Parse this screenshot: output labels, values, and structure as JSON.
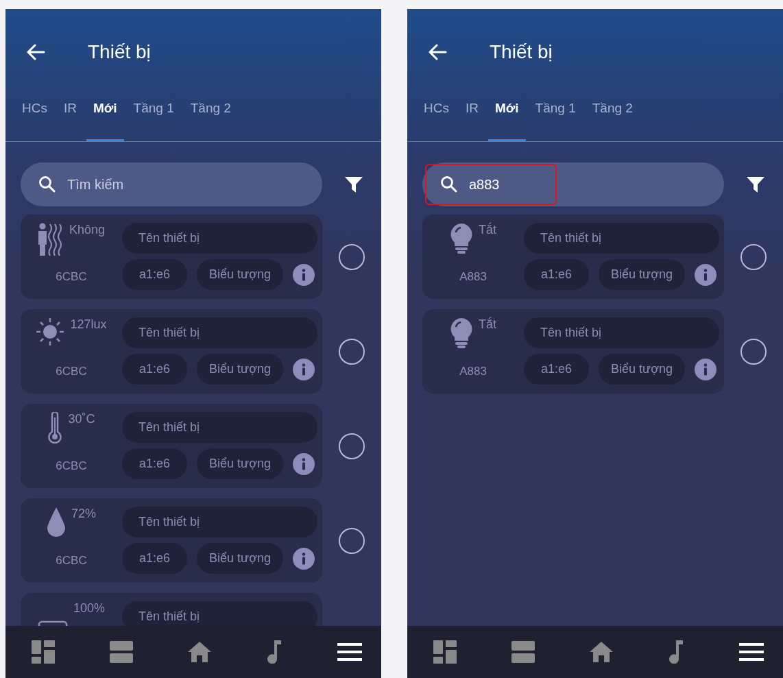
{
  "screens": [
    {
      "title": "Thiết bị",
      "tabs": [
        {
          "label": "HCs",
          "selected": false
        },
        {
          "label": "IR",
          "selected": false
        },
        {
          "label": "Mới",
          "selected": true
        },
        {
          "label": "Tầng 1",
          "selected": false
        },
        {
          "label": "Tầng 2",
          "selected": false
        }
      ],
      "search": {
        "placeholder": "Tìm kiếm",
        "highlighted": false
      },
      "devices": [
        {
          "kind": "presence",
          "reading": "Không",
          "code": "6CBC",
          "name_placeholder": "Tên thiết bị",
          "address": "a1:e6",
          "icon_label": "Biểu tượng",
          "selected": false
        },
        {
          "kind": "light",
          "reading": "127lux",
          "code": "6CBC",
          "name_placeholder": "Tên thiết bị",
          "address": "a1:e6",
          "icon_label": "Biểu tượng",
          "selected": false
        },
        {
          "kind": "temperature",
          "reading": "30˚C",
          "code": "6CBC",
          "name_placeholder": "Tên thiết bị",
          "address": "a1:e6",
          "icon_label": "Biểu tượng",
          "selected": false
        },
        {
          "kind": "humidity",
          "reading": "72%",
          "code": "6CBC",
          "name_placeholder": "Tên thiết bị",
          "address": "a1:e6",
          "icon_label": "Biểu tượng",
          "selected": false
        },
        {
          "kind": "battery",
          "reading": "100%",
          "name_placeholder": "Tên thiết bị"
        }
      ],
      "nav": [
        {
          "kind": "dashboard",
          "selected": false
        },
        {
          "kind": "rooms",
          "selected": false
        },
        {
          "kind": "home",
          "selected": false
        },
        {
          "kind": "music",
          "selected": false
        },
        {
          "kind": "menu",
          "selected": true
        }
      ]
    },
    {
      "title": "Thiết bị",
      "tabs": [
        {
          "label": "HCs",
          "selected": false
        },
        {
          "label": "IR",
          "selected": false
        },
        {
          "label": "Mới",
          "selected": true
        },
        {
          "label": "Tầng 1",
          "selected": false
        },
        {
          "label": "Tầng 2",
          "selected": false
        }
      ],
      "search": {
        "value": "a883",
        "highlighted": true
      },
      "devices": [
        {
          "kind": "bulb",
          "reading": "Tắt",
          "code": "A883",
          "name_placeholder": "Tên thiết bị",
          "address": "a1:e6",
          "icon_label": "Biểu tượng",
          "selected": false
        },
        {
          "kind": "bulb",
          "reading": "Tắt",
          "code": "A883",
          "name_placeholder": "Tên thiết bị",
          "address": "a1:e6",
          "icon_label": "Biểu tượng",
          "selected": false
        }
      ],
      "nav": [
        {
          "kind": "dashboard",
          "selected": false
        },
        {
          "kind": "rooms",
          "selected": false
        },
        {
          "kind": "home",
          "selected": false
        },
        {
          "kind": "music",
          "selected": false
        },
        {
          "kind": "menu",
          "selected": true
        }
      ]
    }
  ]
}
